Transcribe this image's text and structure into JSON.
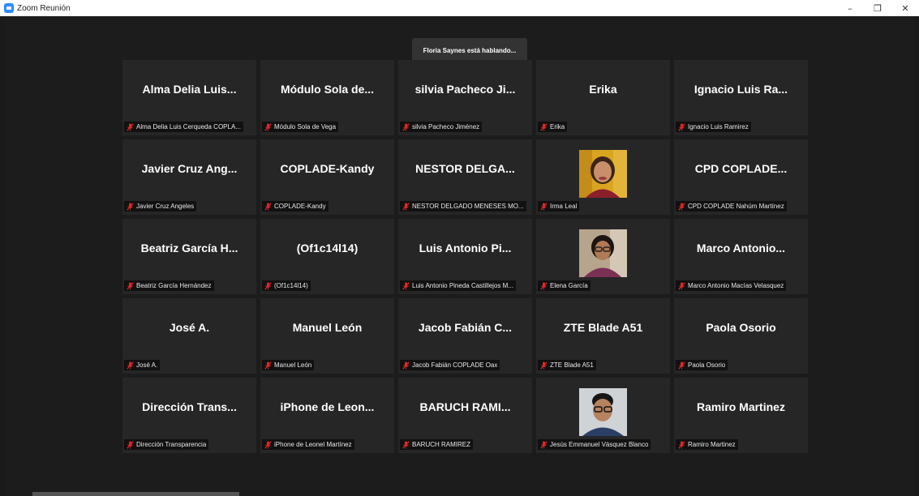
{
  "window": {
    "title": "Zoom Reunión",
    "minimize": "–",
    "maximize": "❐",
    "close": "✕"
  },
  "banner": {
    "speaking": "Floria Saynes está hablando..."
  },
  "tiles": [
    {
      "name": "Alma Delia Luis...",
      "label": "Alma Delia Luis Cerqueda COPLA...",
      "photo": ""
    },
    {
      "name": "Módulo Sola de...",
      "label": "Módulo Sola de Vega",
      "photo": ""
    },
    {
      "name": "silvia Pacheco Ji...",
      "label": "silvia Pacheco Jiménez",
      "photo": ""
    },
    {
      "name": "Erika",
      "label": "Erika",
      "photo": ""
    },
    {
      "name": "Ignacio Luis Ra...",
      "label": "Ignacio Luis Ramirez",
      "photo": ""
    },
    {
      "name": "Javier Cruz Ang...",
      "label": "Javier Cruz Angeles",
      "photo": ""
    },
    {
      "name": "COPLADE-Kandy",
      "label": "COPLADE-Kandy",
      "photo": ""
    },
    {
      "name": "NESTOR DELGA...",
      "label": "NESTOR DELGADO MENESES MO...",
      "photo": ""
    },
    {
      "name": "",
      "label": "Irma Leal",
      "photo": "woman-yellow"
    },
    {
      "name": "CPD COPLADE...",
      "label": "CPD COPLADE Nahúm Martínez",
      "photo": ""
    },
    {
      "name": "Beatriz García H...",
      "label": "Beatriz García Hernández",
      "photo": ""
    },
    {
      "name": "(Of1c14l14)",
      "label": "(Of1c14l14)",
      "photo": ""
    },
    {
      "name": "Luis Antonio Pi...",
      "label": "Luis Antonio Pineda Castillejos M...",
      "photo": ""
    },
    {
      "name": "",
      "label": "Elena García",
      "photo": "woman-glasses"
    },
    {
      "name": "Marco Antonio...",
      "label": "Marco Antonio Macías Velasquez",
      "photo": ""
    },
    {
      "name": "José A.",
      "label": "José A.",
      "photo": ""
    },
    {
      "name": "Manuel León",
      "label": "Manuel León",
      "photo": ""
    },
    {
      "name": "Jacob Fabián C...",
      "label": "Jacob Fabián COPLADE Oax",
      "photo": ""
    },
    {
      "name": "ZTE Blade A51",
      "label": "ZTE Blade A51",
      "photo": ""
    },
    {
      "name": "Paola Osorio",
      "label": "Paola Osorio",
      "photo": ""
    },
    {
      "name": "Dirección Trans...",
      "label": "Dirección Transparencia",
      "photo": ""
    },
    {
      "name": "iPhone de Leon...",
      "label": "iPhone de Leonel Martínez",
      "photo": ""
    },
    {
      "name": "BARUCH RAMI...",
      "label": "BARUCH RAMIREZ",
      "photo": ""
    },
    {
      "name": "",
      "label": "Jesús Emmanuel Vásquez Blanco",
      "photo": "man-glasses"
    },
    {
      "name": "Ramiro Martinez",
      "label": "Ramiro Martinez",
      "photo": ""
    }
  ],
  "colors": {
    "app_accent": "#2D8CFF",
    "muted_mic": "#e02828",
    "tile_bg": "#262626",
    "banner_bg": "#333333"
  }
}
